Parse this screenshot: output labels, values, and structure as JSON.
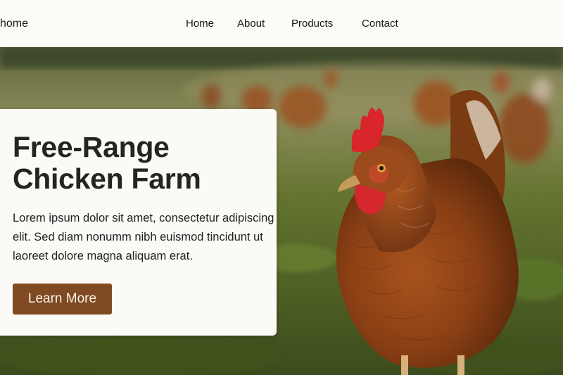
{
  "header": {
    "brand_label": "home",
    "nav": [
      "Home",
      "About",
      "Products",
      "Contact"
    ]
  },
  "hero": {
    "title_line1": "Free-Range",
    "title_line2": "Chicken Farm",
    "body": "Lorem ipsum dolor sit amet, consectetur adipiscing elit. Sed diam nonumm nibh  euismod tincidunt ut laoreet dolore magna aliquam erat.",
    "cta_label": "Learn More",
    "image": "photo of a brown hen standing in a grassy field"
  },
  "colors": {
    "accent": "#7f4a21",
    "card_bg": "#fbfaf7",
    "nav_bg": "#fbfbf7",
    "text": "#262420"
  }
}
